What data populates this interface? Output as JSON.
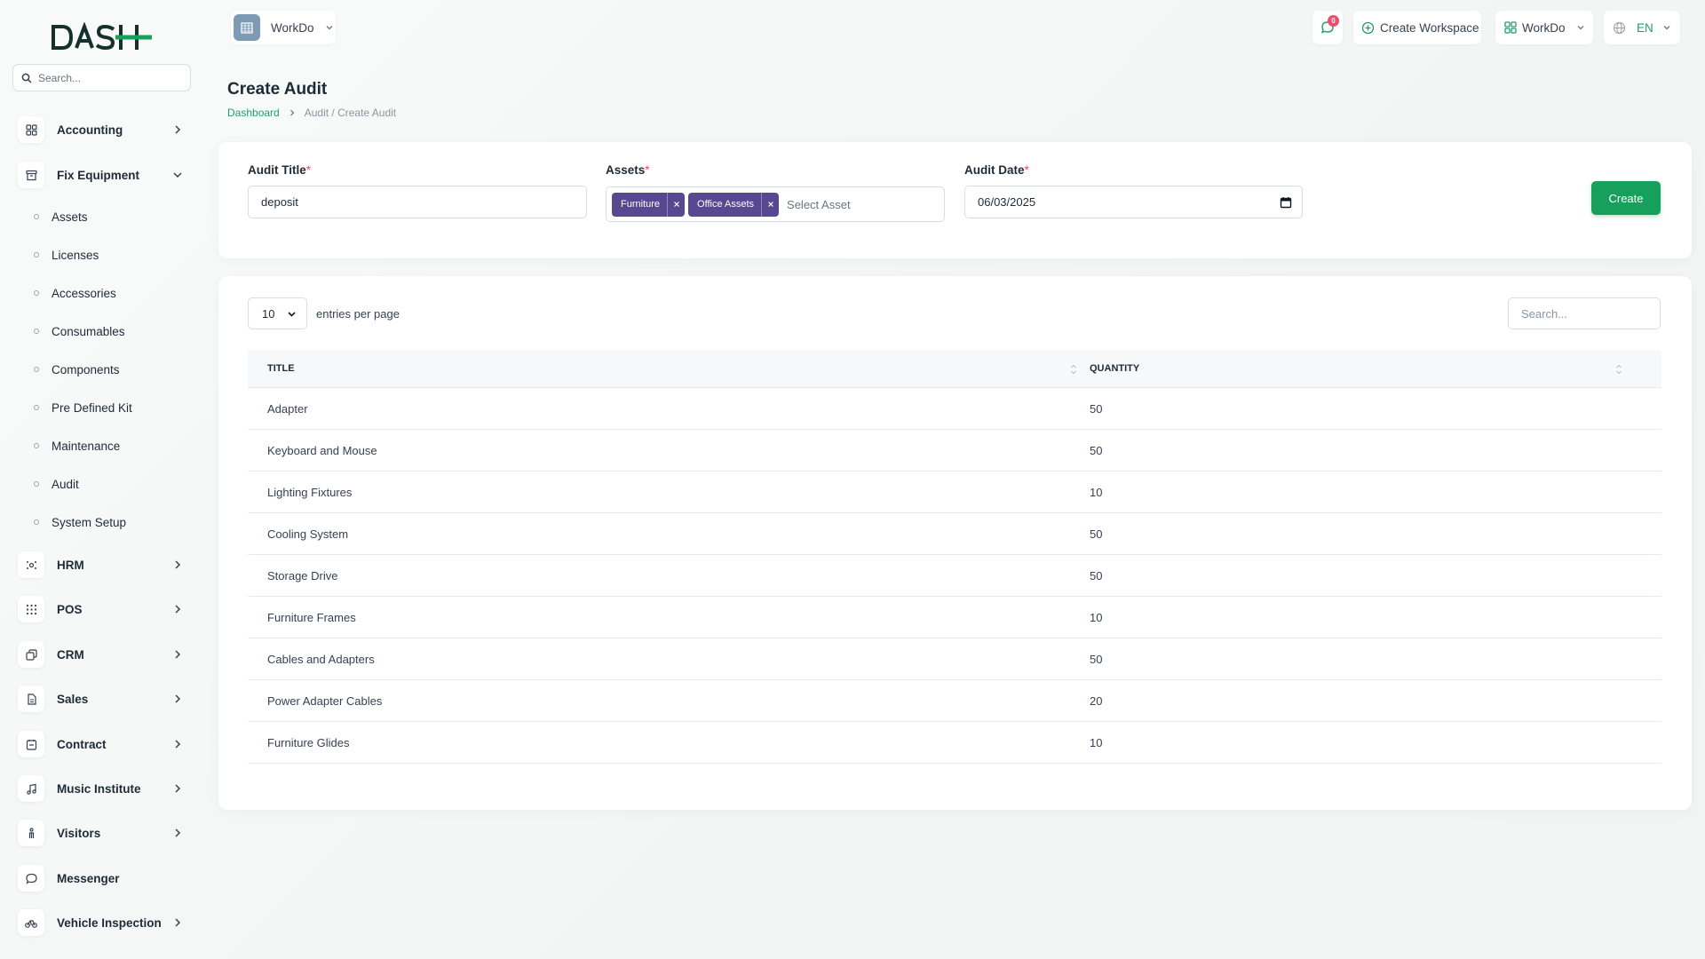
{
  "brand": {
    "logo_text": "DASH"
  },
  "sidebar": {
    "search_placeholder": "Search...",
    "items": [
      {
        "label": "Accounting",
        "icon": "grid-icon",
        "has_children": true,
        "expanded": false
      },
      {
        "label": "Fix Equipment",
        "icon": "archive-icon",
        "has_children": true,
        "expanded": true
      },
      {
        "label": "HRM",
        "icon": "users-icon",
        "has_children": true,
        "expanded": false
      },
      {
        "label": "POS",
        "icon": "dots-grid-icon",
        "has_children": true,
        "expanded": false
      },
      {
        "label": "CRM",
        "icon": "layers-icon",
        "has_children": true,
        "expanded": false
      },
      {
        "label": "Sales",
        "icon": "file-icon",
        "has_children": true,
        "expanded": false
      },
      {
        "label": "Contract",
        "icon": "calendar-icon",
        "has_children": true,
        "expanded": false
      },
      {
        "label": "Music Institute",
        "icon": "music-icon",
        "has_children": true,
        "expanded": false
      },
      {
        "label": "Visitors",
        "icon": "person-icon",
        "has_children": true,
        "expanded": false
      },
      {
        "label": "Messenger",
        "icon": "chat-icon",
        "has_children": false,
        "expanded": false
      },
      {
        "label": "Vehicle Inspection",
        "icon": "bike-icon",
        "has_children": true,
        "expanded": false
      }
    ],
    "sub_items": [
      "Assets",
      "Licenses",
      "Accessories",
      "Consumables",
      "Components",
      "Pre Defined Kit",
      "Maintenance",
      "Audit",
      "System Setup"
    ]
  },
  "header": {
    "workspace_name": "WorkDo",
    "notification_count": "0",
    "create_workspace": "Create Workspace",
    "workspace_switch": "WorkDo",
    "language": "EN"
  },
  "page": {
    "title": "Create Audit",
    "breadcrumb_home": "Dashboard",
    "breadcrumb_rest": "Audit / Create Audit"
  },
  "form": {
    "audit_title_label": "Audit Title",
    "audit_title_value": "deposit",
    "assets_label": "Assets",
    "selected_assets": [
      "Furniture",
      "Office Assets"
    ],
    "assets_placeholder": "Select Asset",
    "audit_date_label": "Audit Date",
    "audit_date_value": "06/03/2025",
    "required_mark": "*",
    "create_button": "Create"
  },
  "table": {
    "entries_value": "10",
    "entries_label": "entries per page",
    "search_placeholder": "Search...",
    "columns": [
      "TITLE",
      "QUANTITY"
    ],
    "rows": [
      [
        "Adapter",
        "50"
      ],
      [
        "Keyboard and Mouse",
        "50"
      ],
      [
        "Lighting Fixtures",
        "10"
      ],
      [
        "Cooling System",
        "50"
      ],
      [
        "Storage Drive",
        "50"
      ],
      [
        "Furniture Frames",
        "10"
      ],
      [
        "Cables and Adapters",
        "50"
      ],
      [
        "Power Adapter Cables",
        "20"
      ],
      [
        "Furniture Glides",
        "10"
      ]
    ]
  },
  "colors": {
    "accent_green": "#16a05c",
    "chip_purple": "#564891",
    "link_green": "#1f9d6d",
    "required_red": "#e24b6a"
  }
}
